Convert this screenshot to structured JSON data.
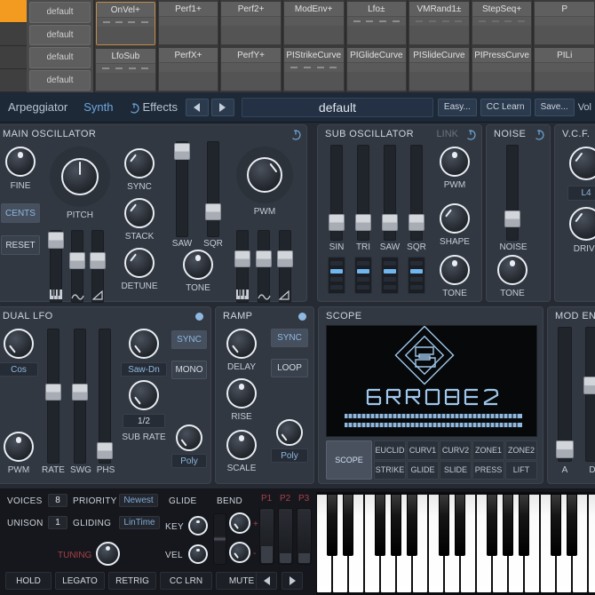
{
  "mod_matrix": {
    "slots": [
      "default",
      "default",
      "default",
      "default"
    ],
    "sources": [
      {
        "label": "OnVel+",
        "dashes": "bright",
        "selected": true
      },
      {
        "label": "Perf1+",
        "dashes": "none",
        "selected": false
      },
      {
        "label": "Perf2+",
        "dashes": "none",
        "selected": false
      },
      {
        "label": "ModEnv+",
        "dashes": "none",
        "selected": false
      },
      {
        "label": "Lfo±",
        "dashes": "bright",
        "selected": false
      },
      {
        "label": "VMRand1±",
        "dashes": "dim",
        "selected": false
      },
      {
        "label": "StepSeq+",
        "dashes": "dim",
        "selected": false
      },
      {
        "label": "P",
        "dashes": "none",
        "selected": false
      }
    ],
    "sources_row2": [
      {
        "label": "LfoSub",
        "dashes": "bright",
        "selected": false
      },
      {
        "label": "PerfX+",
        "dashes": "none",
        "selected": false
      },
      {
        "label": "PerfY+",
        "dashes": "none",
        "selected": false
      },
      {
        "label": "PIStrikeCurve",
        "dashes": "bright",
        "selected": false
      },
      {
        "label": "PIGlideCurve",
        "dashes": "none",
        "selected": false
      },
      {
        "label": "PISlideCurve",
        "dashes": "none",
        "selected": false
      },
      {
        "label": "PIPressCurve",
        "dashes": "none",
        "selected": false
      },
      {
        "label": "PILi",
        "dashes": "none",
        "selected": false
      }
    ]
  },
  "header": {
    "tab_arpeggiator": "Arpeggiator",
    "tab_synth": "Synth",
    "tab_effects": "Effects",
    "preset_name": "default",
    "btn_easy": "Easy...",
    "btn_cc_learn": "CC Learn",
    "btn_save": "Save...",
    "vol_label": "Vol"
  },
  "main_oscillator": {
    "title": "MAIN OSCILLATOR",
    "fine": "FINE",
    "cents": "CENTS",
    "reset": "RESET",
    "pitch": "PITCH",
    "sync": "SYNC",
    "stack": "STACK",
    "detune": "DETUNE",
    "saw": "SAW",
    "sqr": "SQR",
    "tone": "TONE",
    "pwm": "PWM",
    "mod_icons_left": [
      "keyboard-icon",
      "sine-icon",
      "ramp-icon"
    ],
    "mod_icons_right": [
      "keyboard-icon",
      "sine-icon",
      "ramp-icon"
    ]
  },
  "sub_oscillator": {
    "title": "SUB OSCILLATOR",
    "link": "LINK",
    "sliders": [
      "SIN",
      "TRI",
      "SAW",
      "SQR"
    ],
    "pwm": "PWM",
    "shape": "SHAPE",
    "tone": "TONE"
  },
  "noise": {
    "title": "NOISE",
    "noise": "NOISE",
    "tone": "TONE"
  },
  "vcf": {
    "title": "V.C.F.",
    "mode": "L4",
    "drive": "DRIVE"
  },
  "dual_lfo": {
    "title": "DUAL LFO",
    "waveform": "Cos",
    "pwm": "PWM",
    "rate": "RATE",
    "swg": "SWG",
    "phs": "PHS",
    "sub_wave": "Saw-Dn",
    "sub_rate_value": "1/2",
    "sub_rate_label": "SUB RATE",
    "sync": "SYNC",
    "mono": "MONO",
    "poly": "Poly"
  },
  "ramp": {
    "title": "RAMP",
    "delay": "DELAY",
    "rise": "RISE",
    "scale": "SCALE",
    "sync": "SYNC",
    "loop": "LOOP",
    "poly": "Poly"
  },
  "scope": {
    "title": "SCOPE",
    "logo_text": "STROBE2",
    "tab_scope": "SCOPE",
    "tabs_row1": [
      "EUCLID",
      "CURV1",
      "CURV2",
      "ZONE1",
      "ZONE2"
    ],
    "tabs_row2": [
      "STRIKE",
      "GLIDE",
      "SLIDE",
      "PRESS",
      "LIFT"
    ]
  },
  "mod_env": {
    "title": "MOD ENV",
    "a": "A",
    "d": "D"
  },
  "voice_panel": {
    "voices_label": "VOICES",
    "voices_value": "8",
    "unison_label": "UNISON",
    "unison_value": "1",
    "priority_label": "PRIORITY",
    "priority_value": "Newest",
    "gliding_label": "GLIDING",
    "gliding_value": "LinTime",
    "tuning_label": "TUNING",
    "glide_label": "GLIDE",
    "key_label": "KEY",
    "vel_label": "VEL",
    "bend_label": "BEND",
    "bend_plus": "+",
    "bend_minus": "-",
    "perf_faders": [
      "P1",
      "P2",
      "P3"
    ],
    "buttons": [
      "HOLD",
      "LEGATO",
      "RETRIG",
      "CC LRN",
      "MUTE"
    ]
  },
  "colors": {
    "accent_blue": "#6fa8dc",
    "led_blue": "#6fb7ee",
    "orange": "#f29b20",
    "red": "#a8404a",
    "panel": "#323841",
    "header": "#1e2938"
  }
}
